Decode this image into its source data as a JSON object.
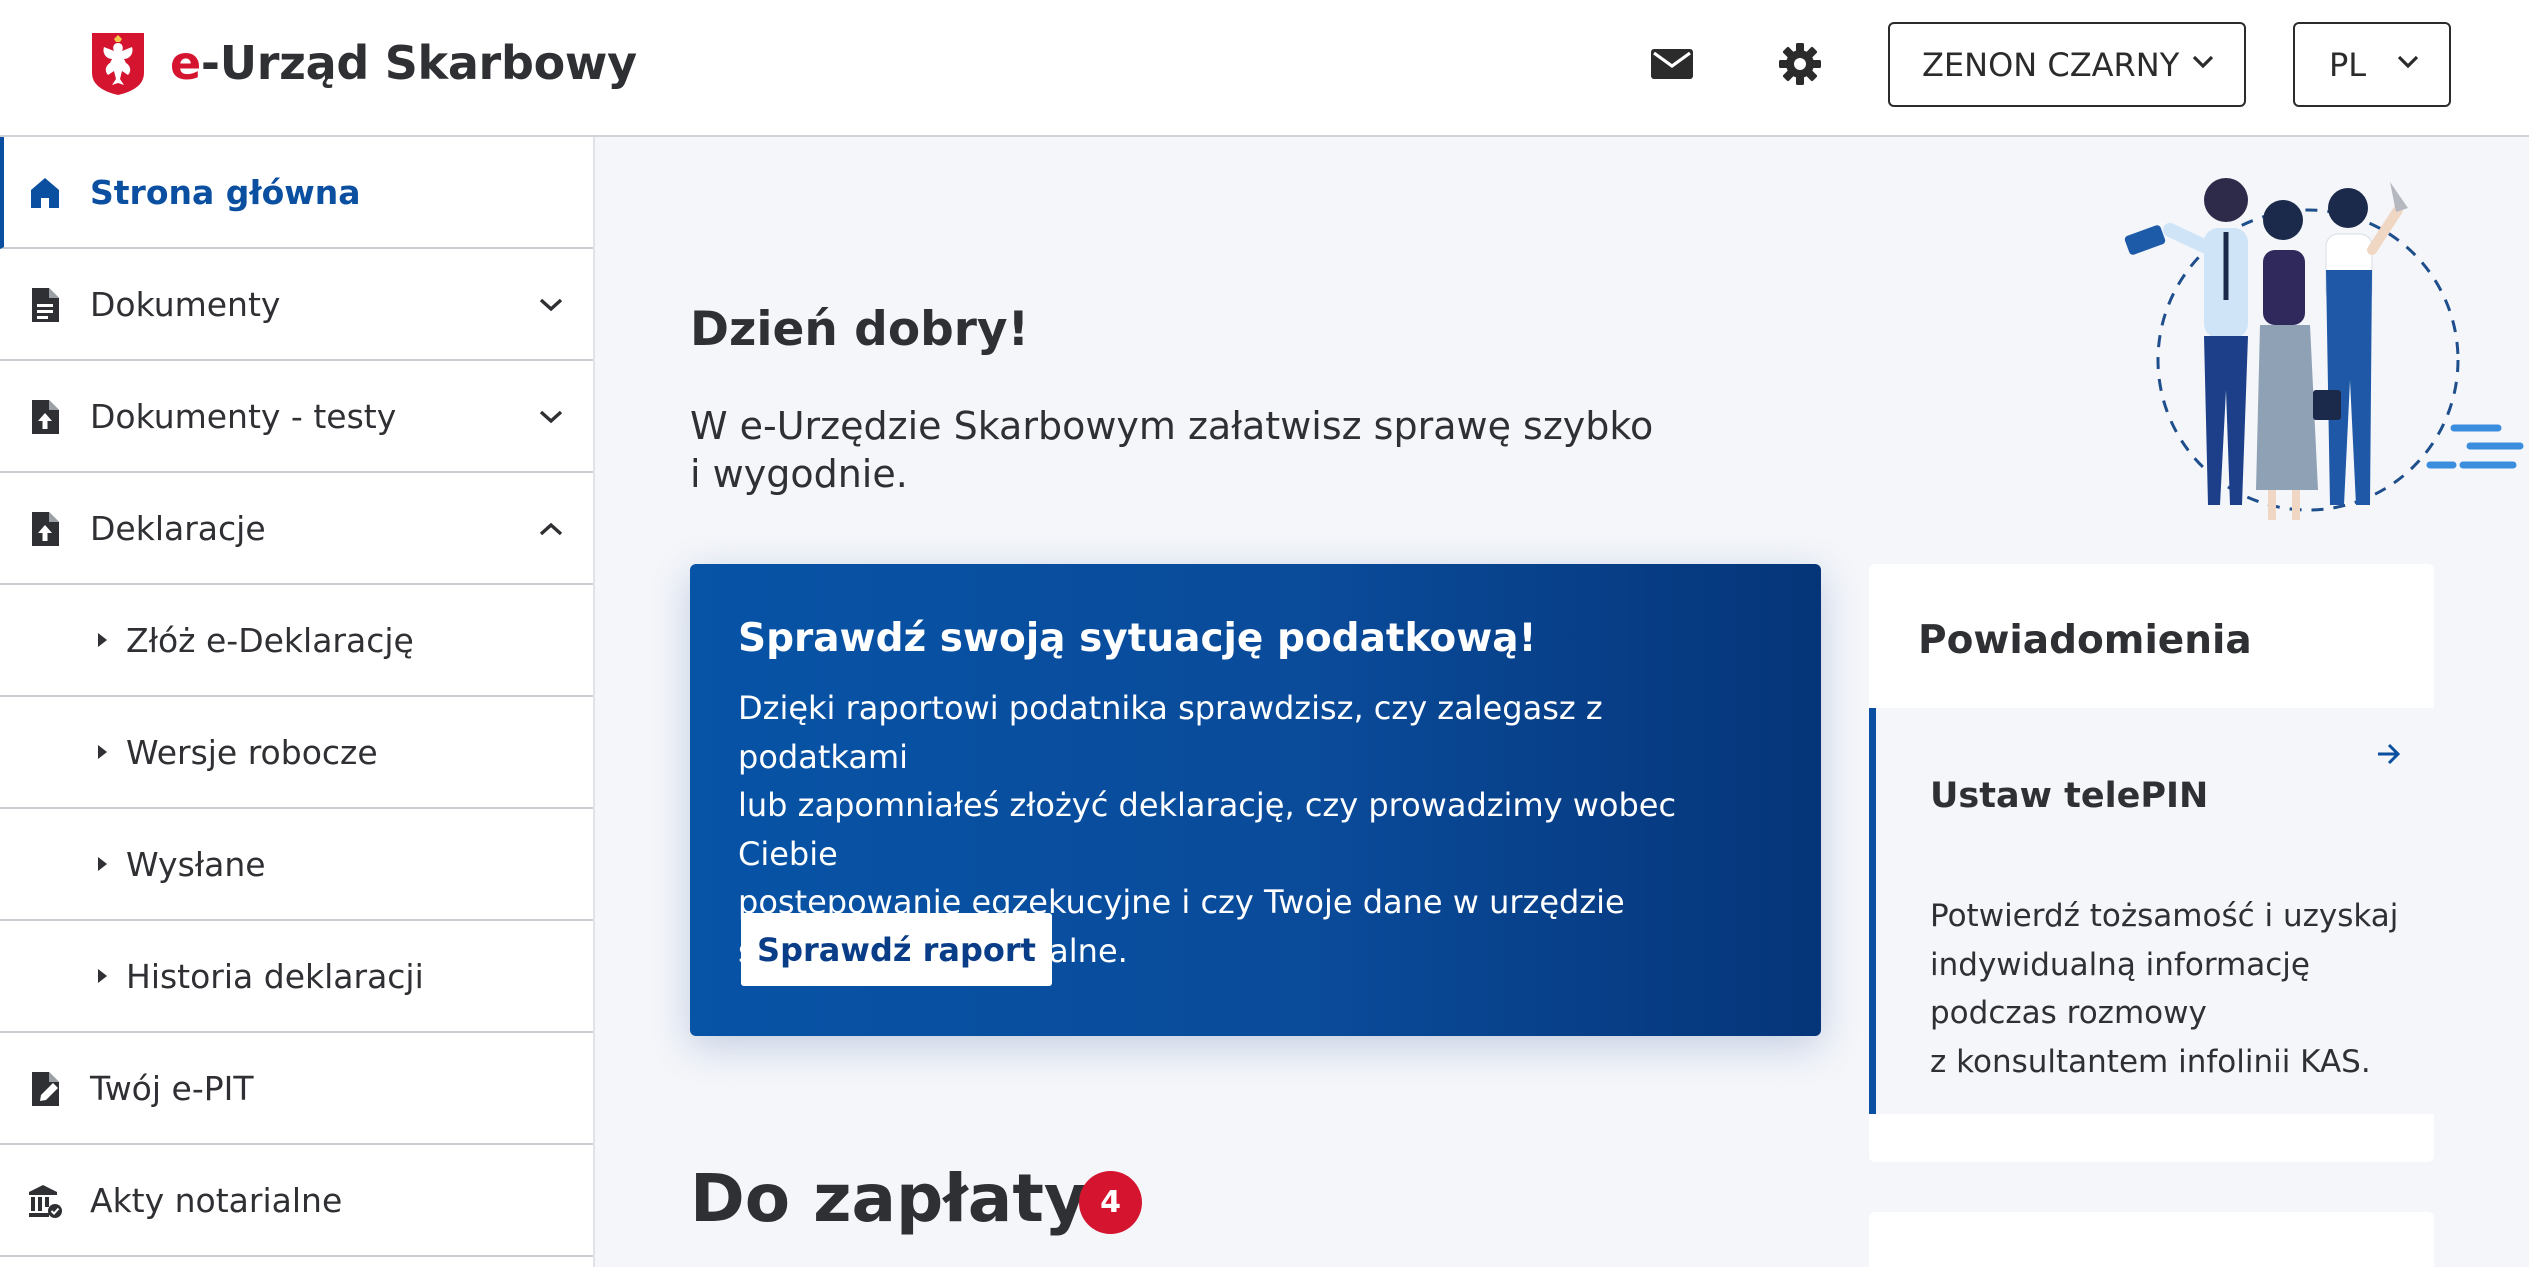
{
  "header": {
    "logo_prefix": "e",
    "logo_rest": "-Urząd Skarbowy",
    "user_label": "ZENON CZARNY",
    "language_label": "PL",
    "icons": [
      "mail-icon",
      "gear-icon",
      "chevron-down-icon"
    ]
  },
  "sidebar": {
    "items": [
      {
        "label": "Strona główna",
        "icon": "home-icon",
        "active": true
      },
      {
        "label": "Dokumenty",
        "icon": "document-icon",
        "expanded": false
      },
      {
        "label": "Dokumenty - testy",
        "icon": "document-upload-icon",
        "expanded": false
      },
      {
        "label": "Deklaracje",
        "icon": "document-upload-icon",
        "expanded": true
      },
      {
        "label": "Złóż e-Deklarację",
        "sub": true
      },
      {
        "label": "Wersje robocze",
        "sub": true
      },
      {
        "label": "Wysłane",
        "sub": true
      },
      {
        "label": "Historia deklaracji",
        "sub": true
      },
      {
        "label": "Twój e-PIT",
        "icon": "document-edit-icon"
      },
      {
        "label": "Akty notarialne",
        "icon": "institution-icon"
      }
    ]
  },
  "main": {
    "greeting": "Dzień dobry!",
    "intro_line1": "W e-Urzędzie Skarbowym załatwisz sprawę szybko",
    "intro_line2": "i wygodnie.",
    "promo": {
      "title": "Sprawdź swoją sytuację podatkową!",
      "text_lines": [
        "Dzięki raportowi podatnika sprawdzisz, czy zalegasz z podatkami",
        "lub zapomniałeś złożyć deklarację, czy prowadzimy wobec Ciebie",
        "postępowanie egzekucyjne i czy Twoje dane w urzędzie",
        "skarbowym są aktualne."
      ],
      "button_label": "Sprawdź raport"
    },
    "notifications": {
      "title": "Powiadomienia",
      "card_title": "Ustaw telePIN",
      "card_text_lines": [
        "Potwierdź tożsamość i uzyskaj",
        "indywidualną informację",
        "podczas rozmowy",
        "z konsultantem infolinii KAS."
      ]
    },
    "due": {
      "title": "Do zapłaty",
      "count": "4"
    }
  },
  "colors": {
    "brand_blue": "#0a4fa0",
    "accent_red": "#d5152f",
    "promo_dark": "#053579"
  }
}
